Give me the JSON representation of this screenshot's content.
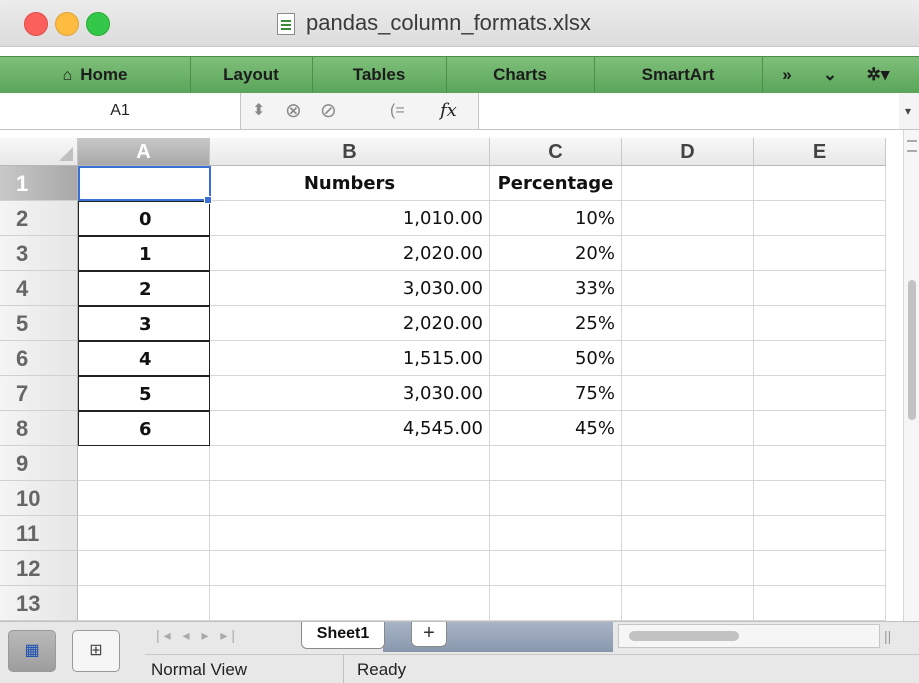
{
  "window": {
    "title": "pandas_column_formats.xlsx"
  },
  "ribbon": {
    "tabs": [
      "Home",
      "Layout",
      "Tables",
      "Charts",
      "SmartArt"
    ],
    "overflow_label": "»",
    "more_label": "⌄"
  },
  "formula_bar": {
    "name_box": "A1",
    "fx_label": "fx",
    "value": ""
  },
  "sheet": {
    "columns": [
      "A",
      "B",
      "C",
      "D",
      "E"
    ],
    "rows": [
      "1",
      "2",
      "3",
      "4",
      "5",
      "6",
      "7",
      "8",
      "9",
      "10",
      "11",
      "12",
      "13"
    ],
    "header_row": [
      "",
      "Numbers",
      "Percentage"
    ],
    "data": [
      [
        "0",
        "1,010.00",
        "10%"
      ],
      [
        "1",
        "2,020.00",
        "20%"
      ],
      [
        "2",
        "3,030.00",
        "33%"
      ],
      [
        "3",
        "2,020.00",
        "25%"
      ],
      [
        "4",
        "1,515.00",
        "50%"
      ],
      [
        "5",
        "3,030.00",
        "75%"
      ],
      [
        "6",
        "4,545.00",
        "45%"
      ]
    ],
    "selected_cell": "A1"
  },
  "tabs": {
    "sheet_name": "Sheet1",
    "add_label": "+"
  },
  "status": {
    "view": "Normal View",
    "state": "Ready"
  },
  "colors": {
    "ribbon": "#6bb26a",
    "selection": "#3b6fd6"
  }
}
